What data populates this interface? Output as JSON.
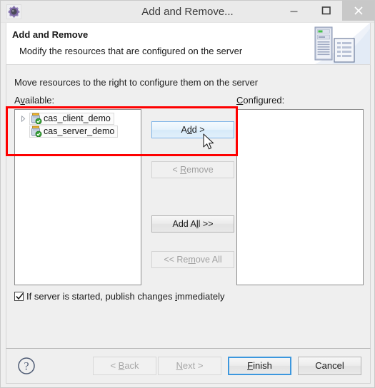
{
  "window": {
    "title": "Add and Remove...",
    "icon": "eclipse-server-icon",
    "controls": {
      "minimize": "minimize-icon",
      "maximize": "maximize-icon",
      "close": "close-icon"
    }
  },
  "banner": {
    "heading": "Add and Remove",
    "description": "Modify the resources that are configured on the server",
    "art": "server-and-document-illustration"
  },
  "body": {
    "instruction": "Move resources to the right to configure them on the server",
    "available": {
      "label_pre": "A",
      "label_mnemonic": "v",
      "label_post": "ailable:",
      "label_full": "Available:",
      "items": [
        {
          "name": "cas_client_demo",
          "icon": "jar-module-icon",
          "expandable": true
        },
        {
          "name": "cas_server_demo",
          "icon": "jar-module-icon",
          "expandable": false
        }
      ]
    },
    "configured": {
      "label_pre": "C",
      "label_mnemonic": "",
      "label_post": "onfigured:",
      "label_full": "Configured:",
      "items": []
    },
    "transfer_buttons": [
      {
        "id": "add",
        "pre": "A",
        "mnemonic": "d",
        "post": "d >",
        "label": "Add >",
        "state": "hover"
      },
      {
        "id": "remove",
        "pre": "< ",
        "mnemonic": "R",
        "post": "emove",
        "label": "< Remove",
        "state": "disabled"
      },
      {
        "id": "add_all",
        "pre": "Add A",
        "mnemonic": "l",
        "post": "l >>",
        "label": "Add All >>",
        "state": "enabled"
      },
      {
        "id": "remove_all",
        "pre": "<< Re",
        "mnemonic": "m",
        "post": "ove All",
        "label": "<< Remove All",
        "state": "disabled"
      }
    ],
    "checkbox": {
      "pre": "If server is started, publish changes ",
      "mnemonic": "i",
      "post": "mmediately",
      "label": "If server is started, publish changes immediately",
      "checked": true
    }
  },
  "footer": {
    "help": "help-icon",
    "buttons": [
      {
        "id": "back",
        "pre": "< ",
        "mnemonic": "B",
        "post": "ack",
        "label": "< Back",
        "state": "disabled"
      },
      {
        "id": "next",
        "pre": "",
        "mnemonic": "N",
        "post": "ext >",
        "label": "Next >",
        "state": "disabled"
      },
      {
        "id": "finish",
        "pre": "",
        "mnemonic": "F",
        "post": "inish",
        "label": "Finish",
        "state": "default"
      },
      {
        "id": "cancel",
        "pre": "Cancel",
        "mnemonic": "",
        "post": "",
        "label": "Cancel",
        "state": "enabled"
      }
    ]
  },
  "annotations": {
    "highlight_color": "#fe0000",
    "boxes": 1
  },
  "colors": {
    "accent": "#3c97de",
    "highlight": "#fe0000",
    "dialog_bg": "#efefef",
    "list_bg": "#ffffff"
  }
}
